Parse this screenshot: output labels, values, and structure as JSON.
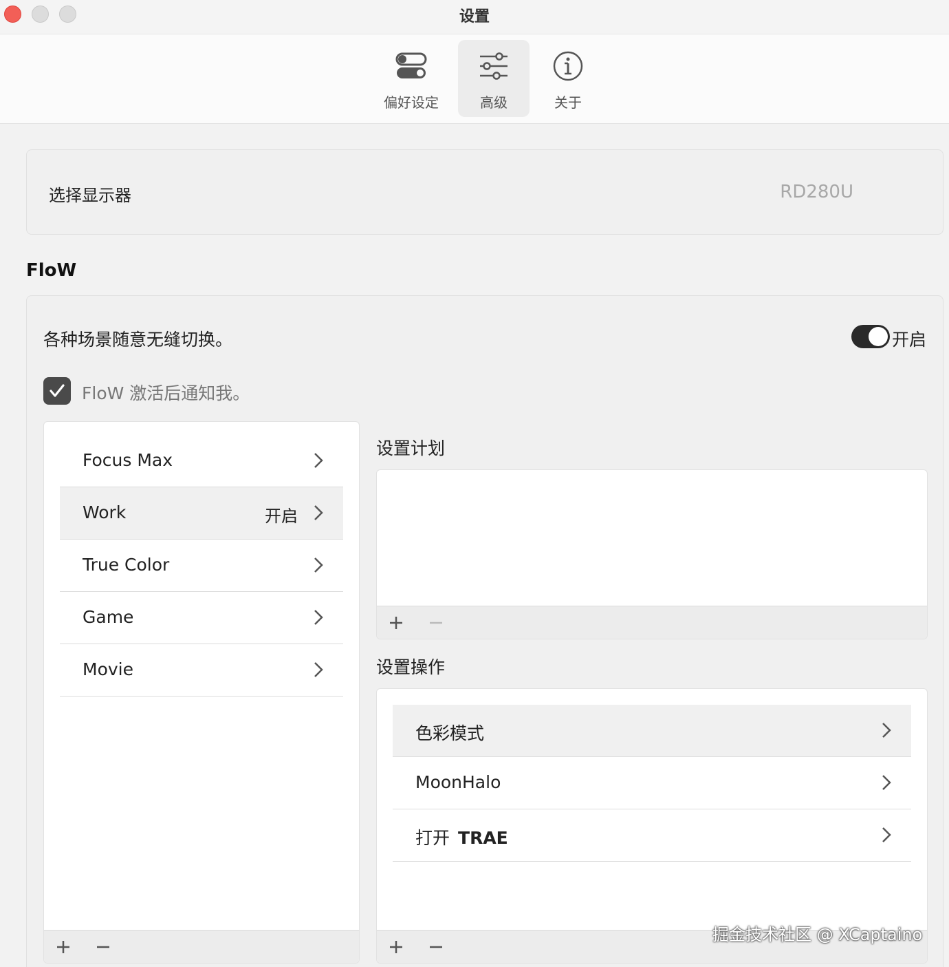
{
  "window": {
    "title": "设置"
  },
  "tabs": [
    {
      "label": "偏好设定",
      "icon": "toggles-icon"
    },
    {
      "label": "高级",
      "icon": "sliders-icon"
    },
    {
      "label": "关于",
      "icon": "info-icon"
    }
  ],
  "monitor": {
    "label": "选择显示器",
    "value": "RD280U"
  },
  "flow": {
    "title": "FloW",
    "description": "各种场景随意无缝切换。",
    "toggle_label": "开启",
    "toggle_on": true,
    "notify_label": "FloW 激活后通知我。",
    "notify_checked": true,
    "scenes": [
      {
        "name": "Focus Max",
        "status": ""
      },
      {
        "name": "Work",
        "status": "开启"
      },
      {
        "name": "True Color",
        "status": ""
      },
      {
        "name": "Game",
        "status": ""
      },
      {
        "name": "Movie",
        "status": ""
      }
    ],
    "plan_title": "设置计划",
    "action_title": "设置操作",
    "actions": [
      {
        "name": "色彩模式",
        "app": ""
      },
      {
        "name": "MoonHalo",
        "app": ""
      },
      {
        "name": "打开",
        "app": "TRAE"
      }
    ]
  },
  "watermark": "掘金技术社区 @ XCaptaino",
  "colors": {
    "close": "#f25f57",
    "toggle": "#2a2a2a",
    "checkbox": "#4a4a4a"
  }
}
